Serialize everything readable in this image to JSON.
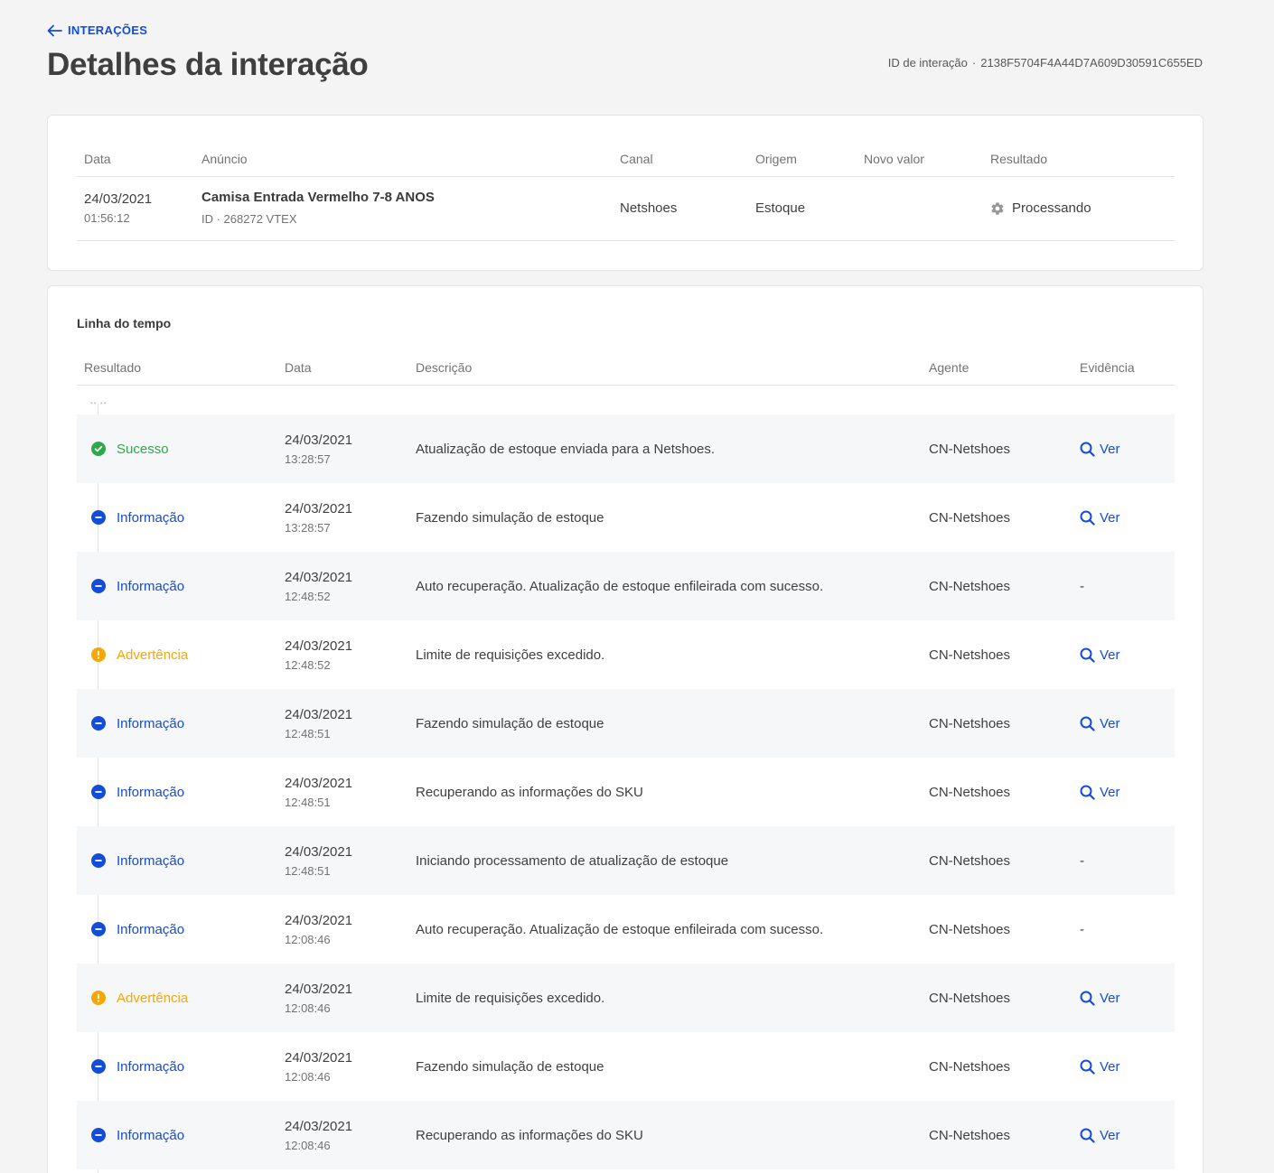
{
  "header": {
    "back_label": "INTERAÇÕES",
    "title": "Detalhes da interação",
    "id_label": "ID de interação",
    "id_separator": "·",
    "id_value": "2138F5704F4A44D7A609D30591C655ED"
  },
  "summary": {
    "columns": {
      "date": "Data",
      "ad": "Anúncio",
      "channel": "Canal",
      "origin": "Origem",
      "new_value": "Novo valor",
      "result": "Resultado"
    },
    "row": {
      "date": "24/03/2021",
      "time": "01:56:12",
      "product_name": "Camisa Entrada Vermelho 7-8 ANOS",
      "product_id": "ID · 268272 VTEX",
      "channel": "Netshoes",
      "origin": "Estoque",
      "new_value": "",
      "result": "Processando"
    }
  },
  "timeline": {
    "title": "Linha do tempo",
    "columns": {
      "result": "Resultado",
      "date": "Data",
      "description": "Descrição",
      "agent": "Agente",
      "evidence": "Evidência"
    },
    "evidence_link_label": "Ver",
    "evidence_empty": "-",
    "colors": {
      "success": "#2fa74a",
      "info": "#134cd8",
      "warning": "#f4a708"
    },
    "rows": [
      {
        "type": "success",
        "result": "Sucesso",
        "date": "24/03/2021",
        "time": "13:28:57",
        "description": "Atualização de estoque enviada para a Netshoes.",
        "agent": "CN-Netshoes",
        "has_evidence": true
      },
      {
        "type": "info",
        "result": "Informação",
        "date": "24/03/2021",
        "time": "13:28:57",
        "description": "Fazendo simulação de estoque",
        "agent": "CN-Netshoes",
        "has_evidence": true
      },
      {
        "type": "info",
        "result": "Informação",
        "date": "24/03/2021",
        "time": "12:48:52",
        "description": "Auto recuperação. Atualização de estoque enfileirada com sucesso.",
        "agent": "CN-Netshoes",
        "has_evidence": false
      },
      {
        "type": "warning",
        "result": "Advertência",
        "date": "24/03/2021",
        "time": "12:48:52",
        "description": "Limite de requisições excedido.",
        "agent": "CN-Netshoes",
        "has_evidence": true
      },
      {
        "type": "info",
        "result": "Informação",
        "date": "24/03/2021",
        "time": "12:48:51",
        "description": "Fazendo simulação de estoque",
        "agent": "CN-Netshoes",
        "has_evidence": true
      },
      {
        "type": "info",
        "result": "Informação",
        "date": "24/03/2021",
        "time": "12:48:51",
        "description": "Recuperando as informações do SKU",
        "agent": "CN-Netshoes",
        "has_evidence": true
      },
      {
        "type": "info",
        "result": "Informação",
        "date": "24/03/2021",
        "time": "12:48:51",
        "description": "Iniciando processamento de atualização de estoque",
        "agent": "CN-Netshoes",
        "has_evidence": false
      },
      {
        "type": "info",
        "result": "Informação",
        "date": "24/03/2021",
        "time": "12:08:46",
        "description": "Auto recuperação. Atualização de estoque enfileirada com sucesso.",
        "agent": "CN-Netshoes",
        "has_evidence": false
      },
      {
        "type": "warning",
        "result": "Advertência",
        "date": "24/03/2021",
        "time": "12:08:46",
        "description": "Limite de requisições excedido.",
        "agent": "CN-Netshoes",
        "has_evidence": true
      },
      {
        "type": "info",
        "result": "Informação",
        "date": "24/03/2021",
        "time": "12:08:46",
        "description": "Fazendo simulação de estoque",
        "agent": "CN-Netshoes",
        "has_evidence": true
      },
      {
        "type": "info",
        "result": "Informação",
        "date": "24/03/2021",
        "time": "12:08:46",
        "description": "Recuperando as informações do SKU",
        "agent": "CN-Netshoes",
        "has_evidence": true
      }
    ]
  }
}
